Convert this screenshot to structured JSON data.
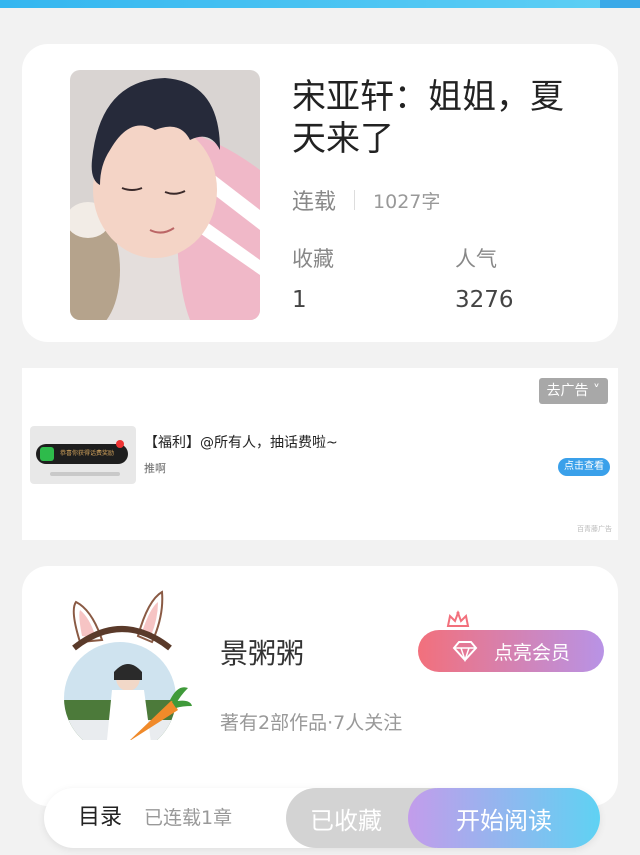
{
  "book": {
    "title": "宋亚轩：姐姐，夏天来了",
    "status": "连载",
    "word_count": "1027字",
    "favorites_label": "收藏",
    "favorites_value": "1",
    "popularity_label": "人气",
    "popularity_value": "3276"
  },
  "ad": {
    "remove_label": "去广告 ˅",
    "headline": "【福利】@所有人，抽话费啦~",
    "source": "推啊",
    "cta_label": "点击查看",
    "thumb_text": "恭喜你获得话费奖励",
    "mark": "百青藤广告"
  },
  "author": {
    "name": "景粥粥",
    "subtitle": "著有2部作品·7人关注",
    "vip_label": "点亮会员"
  },
  "bottom_bar": {
    "toc_label": "目录",
    "toc_count": "已连载1章",
    "favorited_label": "已收藏",
    "read_label": "开始阅读"
  },
  "colors": {
    "accent_top": "#34b6f0",
    "vip_gradient_start": "#f2707c",
    "vip_gradient_end": "#b893e6",
    "read_gradient_start": "#c39ceb",
    "read_gradient_end": "#5fd2f3"
  }
}
